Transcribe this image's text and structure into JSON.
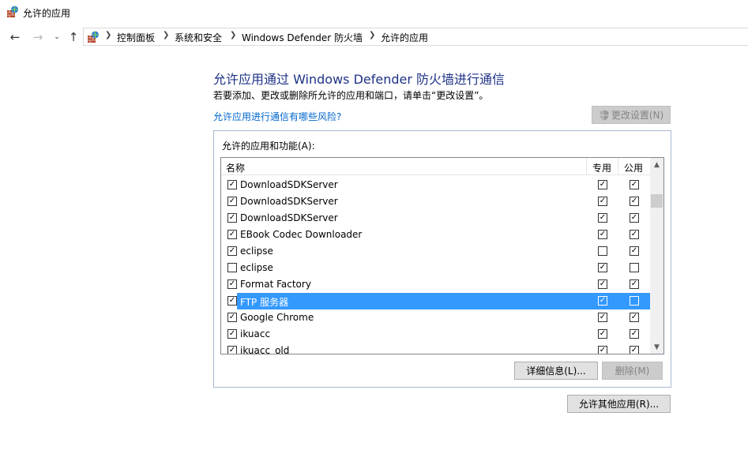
{
  "window": {
    "title": "允许的应用"
  },
  "nav": {
    "back_icon": "arrow-left-icon",
    "forward_icon": "arrow-right-icon",
    "recent_icon": "chevron-down-icon",
    "up_icon": "arrow-up-icon",
    "breadcrumbs": [
      "控制面板",
      "系统和安全",
      "Windows Defender 防火墙",
      "允许的应用"
    ]
  },
  "main": {
    "heading": "允许应用通过 Windows Defender 防火墙进行通信",
    "description": "若要添加、更改或删除所允许的应用和端口，请单击“更改设置”。",
    "risk_link": "允许应用进行通信有哪些风险?",
    "change_settings_label": "更改设置(N)",
    "group_label": "允许的应用和功能(A):",
    "columns": {
      "name": "名称",
      "private": "专用",
      "public": "公用"
    },
    "rows": [
      {
        "enabled": true,
        "name": "DownloadSDKServer",
        "private": true,
        "public": true,
        "selected": false
      },
      {
        "enabled": true,
        "name": "DownloadSDKServer",
        "private": true,
        "public": true,
        "selected": false
      },
      {
        "enabled": true,
        "name": "DownloadSDKServer",
        "private": true,
        "public": true,
        "selected": false
      },
      {
        "enabled": true,
        "name": "EBook Codec Downloader",
        "private": true,
        "public": true,
        "selected": false
      },
      {
        "enabled": true,
        "name": "eclipse",
        "private": false,
        "public": true,
        "selected": false
      },
      {
        "enabled": false,
        "name": "eclipse",
        "private": true,
        "public": false,
        "selected": false
      },
      {
        "enabled": true,
        "name": "Format Factory",
        "private": true,
        "public": true,
        "selected": false
      },
      {
        "enabled": true,
        "name": "FTP 服务器",
        "private": true,
        "public": false,
        "selected": true
      },
      {
        "enabled": true,
        "name": "Google Chrome",
        "private": true,
        "public": true,
        "selected": false
      },
      {
        "enabled": true,
        "name": "ikuacc",
        "private": true,
        "public": true,
        "selected": false
      },
      {
        "enabled": true,
        "name": "ikuacc_old",
        "private": true,
        "public": true,
        "selected": false
      }
    ],
    "details_button": "详细信息(L)...",
    "remove_button": "删除(M)",
    "allow_other_button": "允许其他应用(R)..."
  },
  "colors": {
    "heading": "#1e3287",
    "link": "#0066cc",
    "selection": "#3399ff"
  }
}
